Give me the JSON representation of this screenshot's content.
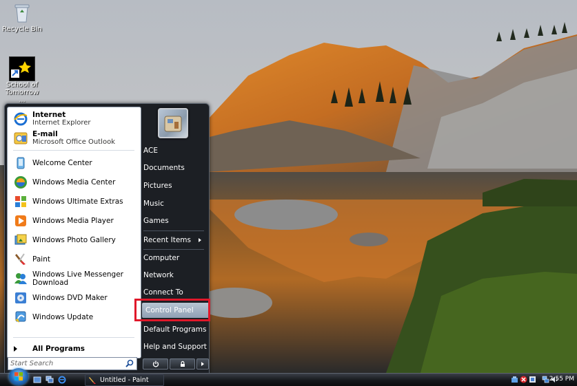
{
  "desktop": {
    "icons": [
      {
        "label": "Recycle Bin"
      },
      {
        "label": "School of Tomorrow ..."
      }
    ]
  },
  "start_menu": {
    "pinned": [
      {
        "title": "Internet",
        "subtitle": "Internet Explorer",
        "icon": "internet-explorer-icon"
      },
      {
        "title": "E-mail",
        "subtitle": "Microsoft Office Outlook",
        "icon": "outlook-icon"
      }
    ],
    "recent": [
      {
        "label": "Welcome Center",
        "icon": "welcome-center-icon"
      },
      {
        "label": "Windows Media Center",
        "icon": "media-center-icon"
      },
      {
        "label": "Windows Ultimate Extras",
        "icon": "ultimate-extras-icon"
      },
      {
        "label": "Windows Media Player",
        "icon": "media-player-icon"
      },
      {
        "label": "Windows Photo Gallery",
        "icon": "photo-gallery-icon"
      },
      {
        "label": "Paint",
        "icon": "paint-icon"
      },
      {
        "label": "Windows Live Messenger Download",
        "icon": "messenger-icon"
      },
      {
        "label": "Windows DVD Maker",
        "icon": "dvd-maker-icon"
      },
      {
        "label": "Windows Update",
        "icon": "windows-update-icon"
      }
    ],
    "all_programs": "All Programs",
    "search_placeholder": "Start Search",
    "right": [
      {
        "label": "ACE"
      },
      {
        "label": "Documents"
      },
      {
        "label": "Pictures"
      },
      {
        "label": "Music"
      },
      {
        "label": "Games"
      },
      {
        "label": "Recent Items"
      },
      {
        "label": "Computer"
      },
      {
        "label": "Network"
      },
      {
        "label": "Connect To"
      },
      {
        "label": "Control Panel"
      },
      {
        "label": "Default Programs"
      },
      {
        "label": "Help and Support"
      }
    ]
  },
  "taskbar": {
    "task_label": "Untitled - Paint",
    "clock": "2:55 PM"
  },
  "colors": {
    "highlight_border": "#e0182a",
    "menu_dark": "#1c1f24",
    "selected_item": "#9fb0c4"
  }
}
